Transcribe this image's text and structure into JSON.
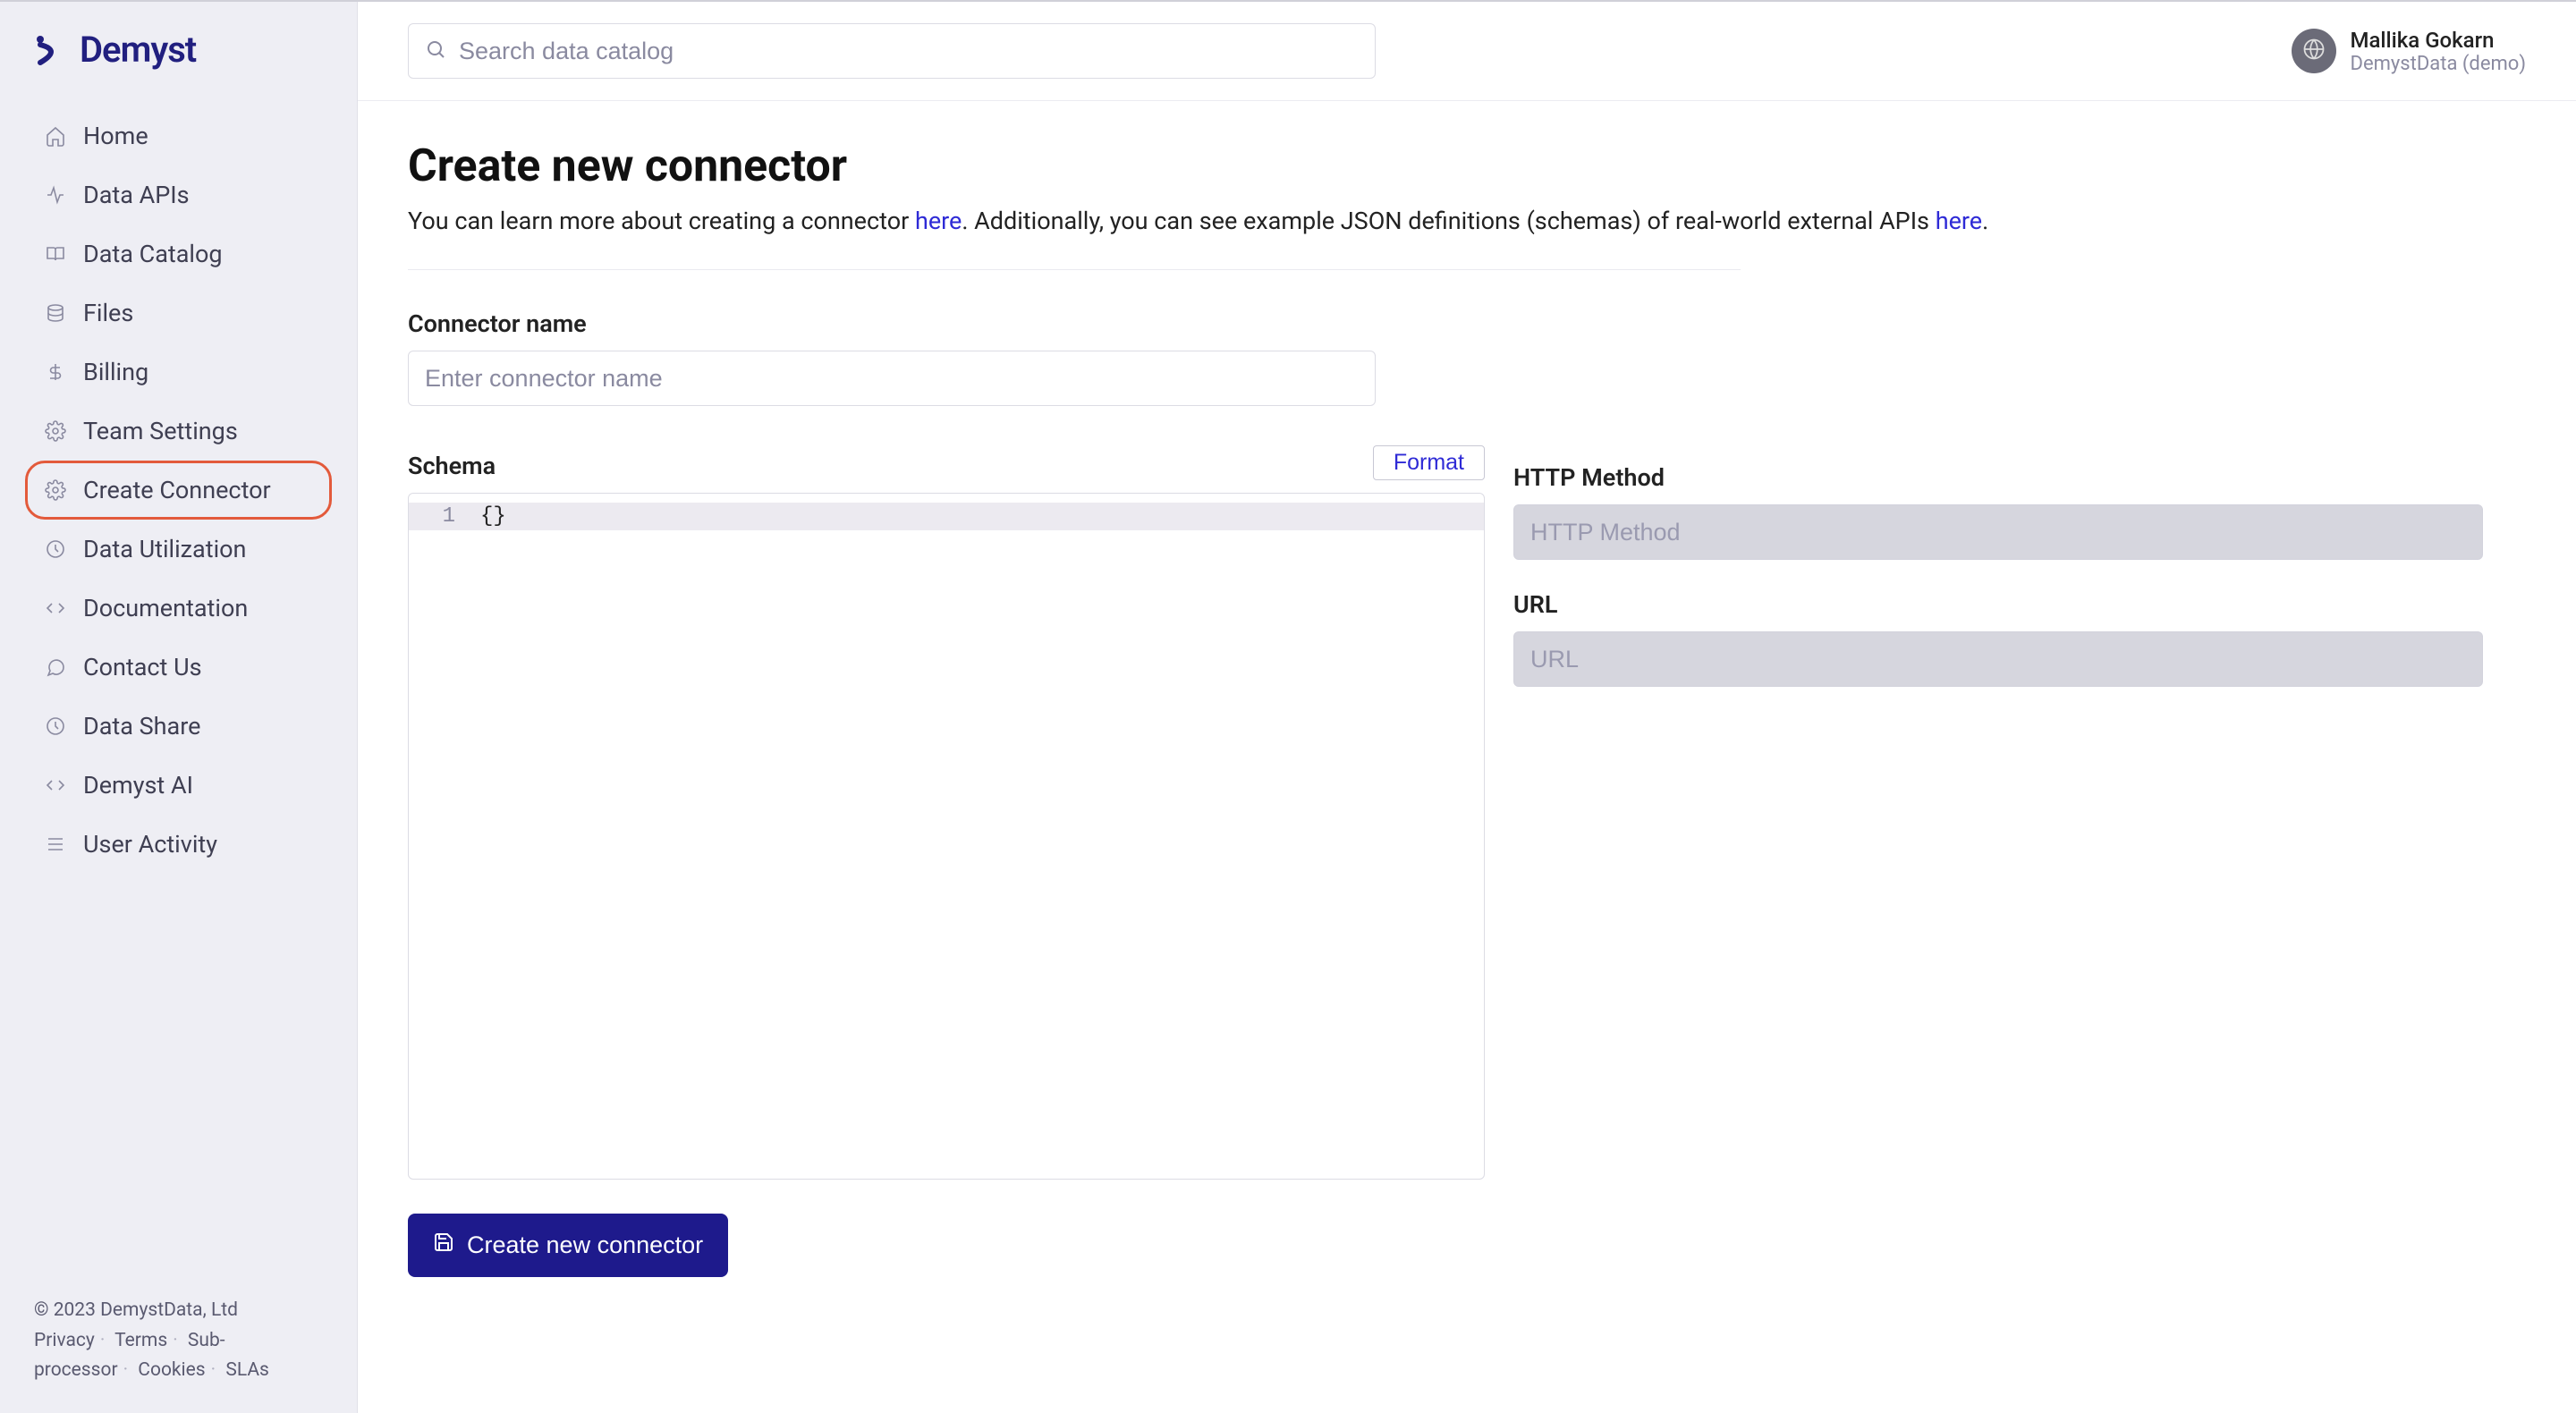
{
  "brand": {
    "name": "Demyst"
  },
  "header": {
    "search_placeholder": "Search data catalog",
    "user_name": "Mallika Gokarn",
    "user_org": "DemystData (demo)"
  },
  "sidebar": {
    "items": [
      {
        "icon": "home-icon",
        "label": "Home"
      },
      {
        "icon": "activity-icon",
        "label": "Data APIs"
      },
      {
        "icon": "book-icon",
        "label": "Data Catalog"
      },
      {
        "icon": "database-icon",
        "label": "Files"
      },
      {
        "icon": "dollar-icon",
        "label": "Billing"
      },
      {
        "icon": "gear-icon",
        "label": "Team Settings"
      },
      {
        "icon": "gear-icon",
        "label": "Create Connector",
        "active": true
      },
      {
        "icon": "clock-icon",
        "label": "Data Utilization"
      },
      {
        "icon": "code-icon",
        "label": "Documentation"
      },
      {
        "icon": "chat-icon",
        "label": "Contact Us"
      },
      {
        "icon": "clock-icon",
        "label": "Data Share"
      },
      {
        "icon": "code-icon",
        "label": "Demyst AI"
      },
      {
        "icon": "list-icon",
        "label": "User Activity"
      }
    ],
    "footer": {
      "copyright": "© 2023 DemystData, Ltd",
      "links": [
        "Privacy",
        "Terms",
        "Sub-processor",
        "Cookies",
        "SLAs"
      ]
    }
  },
  "page": {
    "title": "Create new connector",
    "desc_part1": "You can learn more about creating a connector ",
    "desc_link1": "here",
    "desc_part2": ". Additionally, you can see example JSON definitions (schemas) of real-world external APIs ",
    "desc_link2": "here",
    "desc_part3": "."
  },
  "form": {
    "connector_name_label": "Connector name",
    "connector_name_placeholder": "Enter connector name",
    "schema_label": "Schema",
    "format_btn": "Format",
    "schema_line_number": "1",
    "schema_line_content": "{}",
    "http_method_label": "HTTP Method",
    "http_method_placeholder": "HTTP Method",
    "url_label": "URL",
    "url_placeholder": "URL",
    "submit_btn": "Create new connector"
  }
}
